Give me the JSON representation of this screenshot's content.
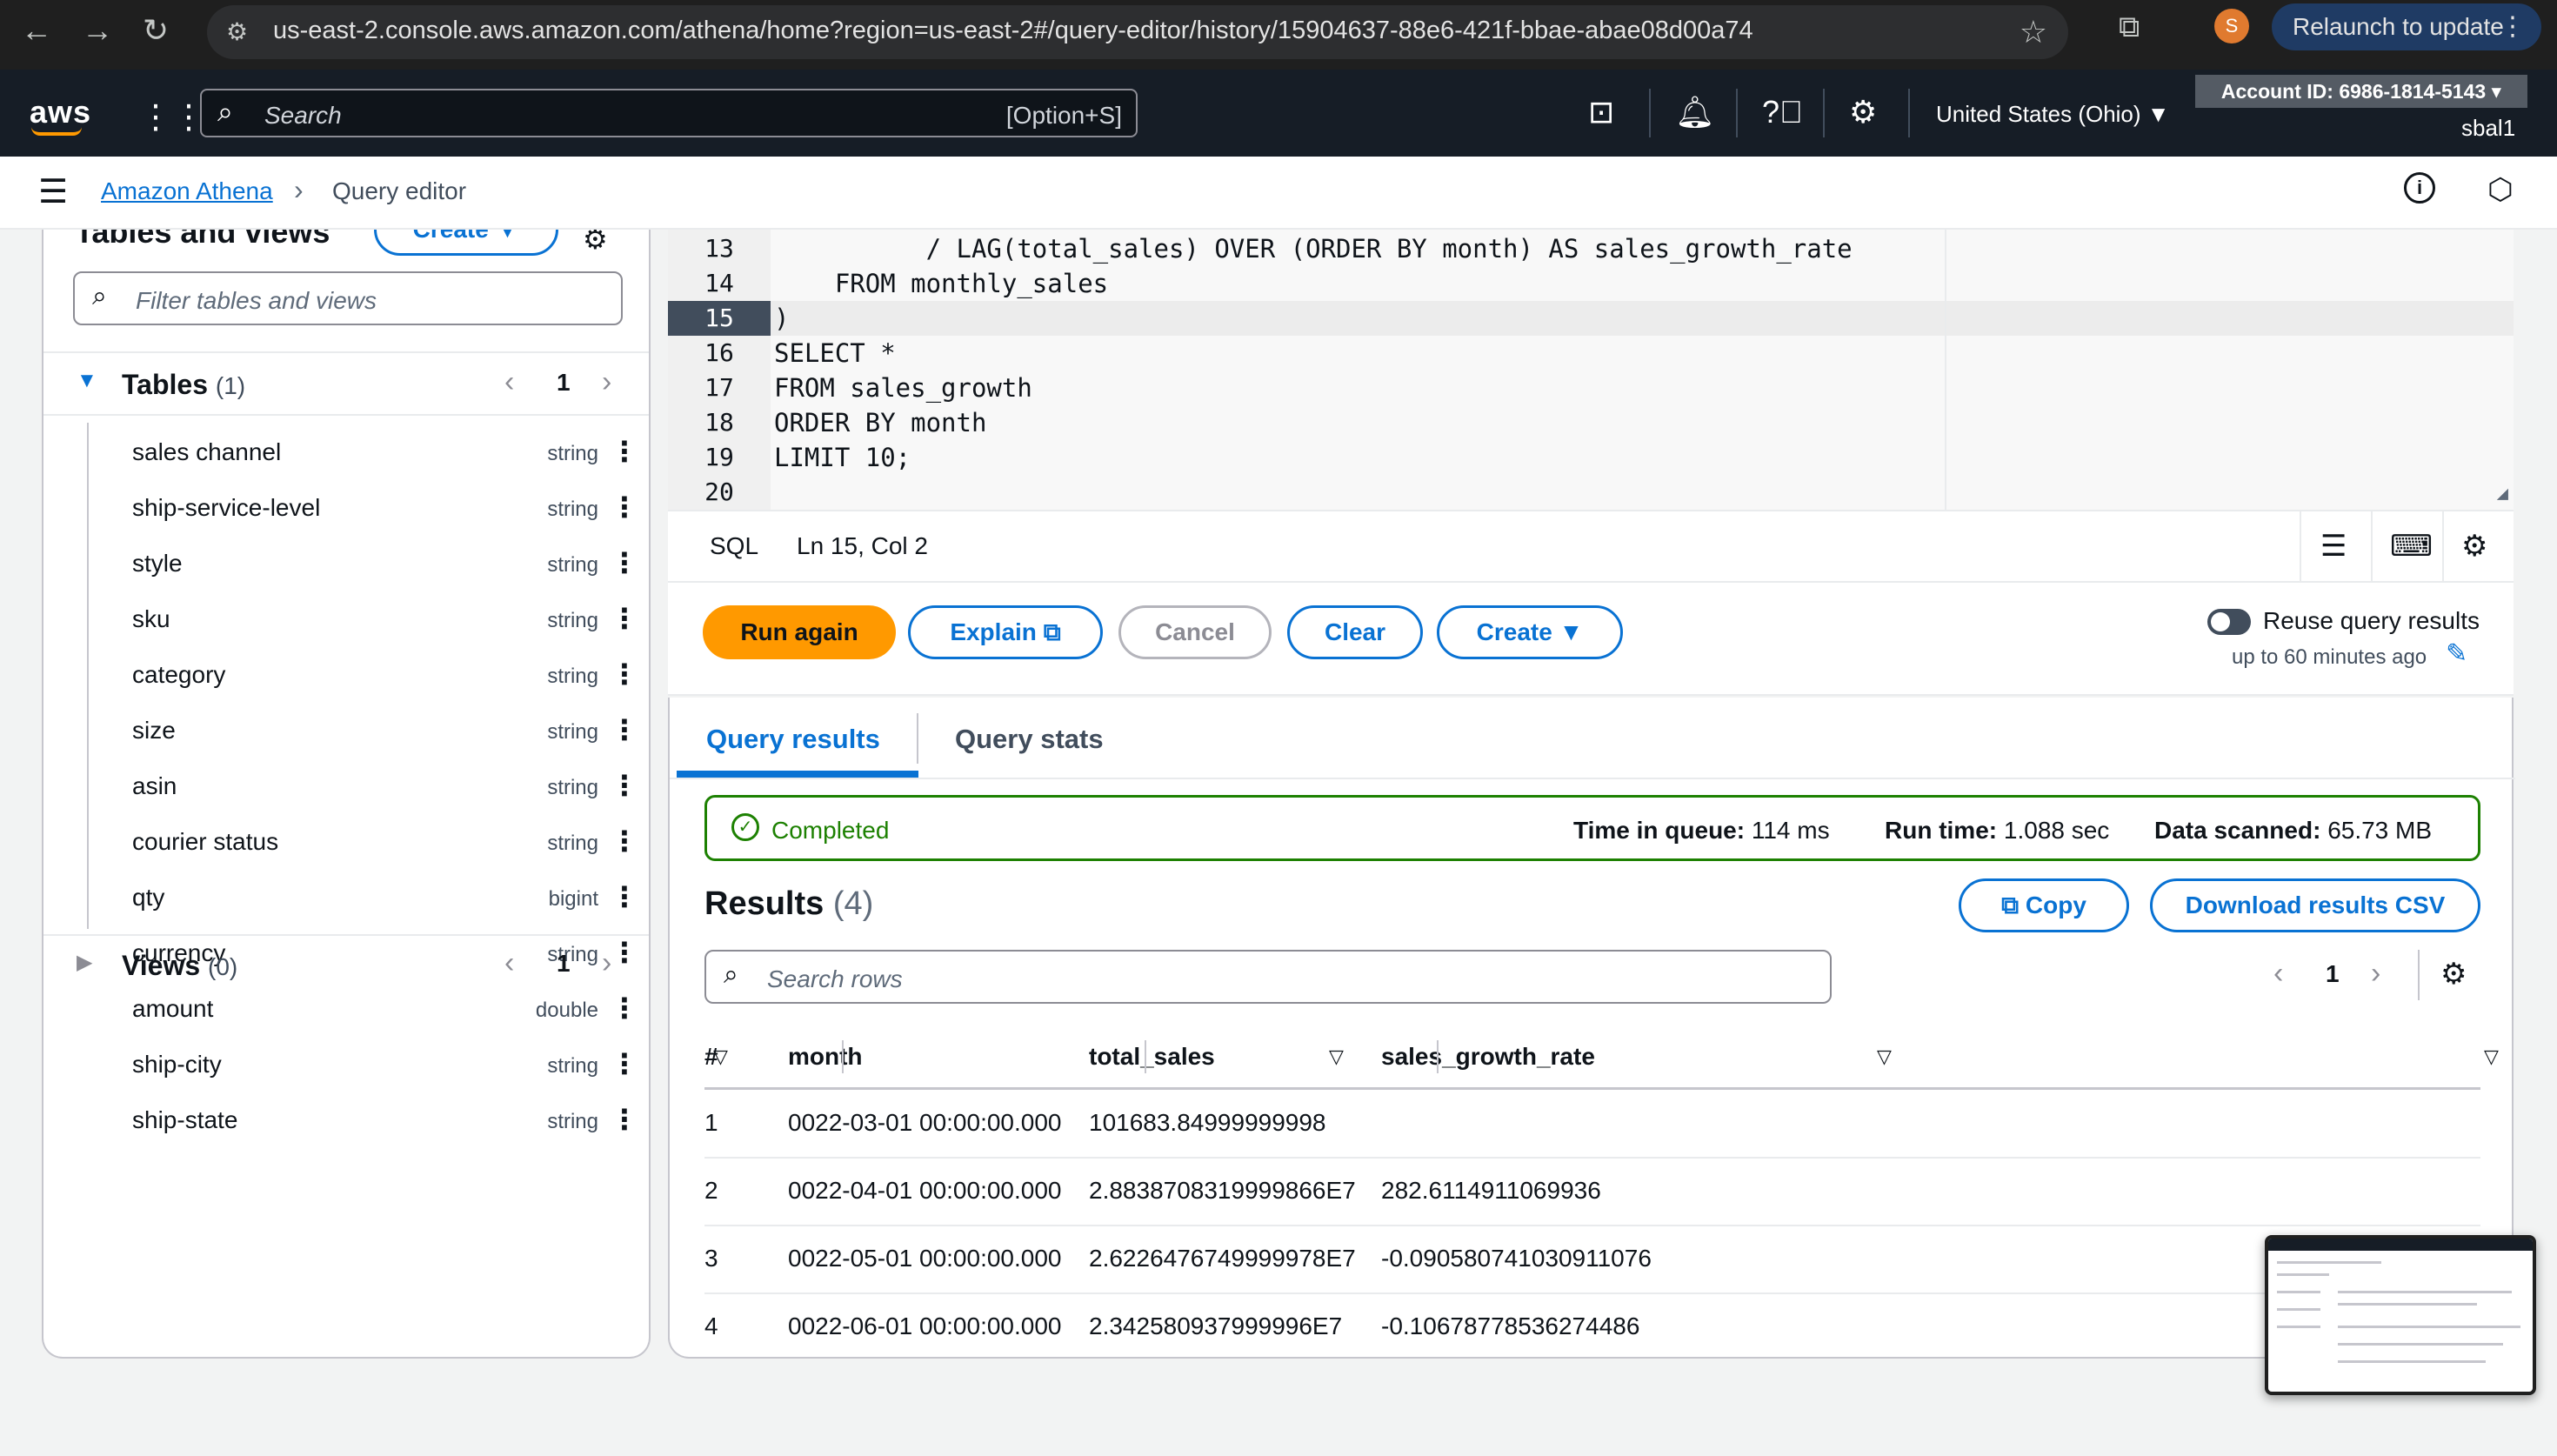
{
  "browser": {
    "url": "us-east-2.console.aws.amazon.com/athena/home?region=us-east-2#/query-editor/history/15904637-88e6-421f-bbae-abae08d00a74",
    "profile_initial": "S",
    "relaunch_label": "Relaunch to update"
  },
  "awsnav": {
    "logo": "aws",
    "search_placeholder": "Search",
    "search_shortcut": "[Option+S]",
    "region": "United States (Ohio)",
    "account": "Account ID: 6986-1814-5143",
    "user": "sbal1"
  },
  "breadcrumb": {
    "service": "Amazon Athena",
    "page": "Query editor"
  },
  "left_panel": {
    "title": "Tables and views",
    "create_label": "Create",
    "filter_placeholder": "Filter tables and views",
    "tables_label": "Tables",
    "tables_count": "(1)",
    "tables_page": "1",
    "views_label": "Views",
    "views_count": "(0)",
    "views_page": "1",
    "columns": [
      {
        "name": "sales channel",
        "type": "string"
      },
      {
        "name": "ship-service-level",
        "type": "string"
      },
      {
        "name": "style",
        "type": "string"
      },
      {
        "name": "sku",
        "type": "string"
      },
      {
        "name": "category",
        "type": "string"
      },
      {
        "name": "size",
        "type": "string"
      },
      {
        "name": "asin",
        "type": "string"
      },
      {
        "name": "courier status",
        "type": "string"
      },
      {
        "name": "qty",
        "type": "bigint"
      },
      {
        "name": "currency",
        "type": "string"
      },
      {
        "name": "amount",
        "type": "double"
      },
      {
        "name": "ship-city",
        "type": "string"
      },
      {
        "name": "ship-state",
        "type": "string"
      }
    ]
  },
  "editor": {
    "lines": [
      {
        "num": "13",
        "text": "          / LAG(total_sales) OVER (ORDER BY month) AS sales_growth_rate"
      },
      {
        "num": "14",
        "text": "    FROM monthly_sales"
      },
      {
        "num": "15",
        "text": ")"
      },
      {
        "num": "16",
        "text": "SELECT *"
      },
      {
        "num": "17",
        "text": "FROM sales_growth"
      },
      {
        "num": "18",
        "text": "ORDER BY month"
      },
      {
        "num": "19",
        "text": "LIMIT 10;"
      },
      {
        "num": "20",
        "text": ""
      }
    ],
    "current_line": "15",
    "language": "SQL",
    "cursor": "Ln 15, Col 2"
  },
  "actions": {
    "run_again": "Run again",
    "explain": "Explain",
    "cancel": "Cancel",
    "clear": "Clear",
    "create": "Create",
    "reuse_label": "Reuse query results",
    "reuse_sub": "up to 60 minutes ago"
  },
  "results": {
    "tab_results": "Query results",
    "tab_stats": "Query stats",
    "status": "Completed",
    "queue_label": "Time in queue:",
    "queue_value": "114 ms",
    "run_label": "Run time:",
    "run_value": "1.088 sec",
    "scan_label": "Data scanned:",
    "scan_value": "65.73 MB",
    "title": "Results",
    "count": "(4)",
    "copy_label": "Copy",
    "download_label": "Download results CSV",
    "search_placeholder": "Search rows",
    "page": "1",
    "columns": [
      "#",
      "month",
      "total_sales",
      "sales_growth_rate"
    ],
    "rows": [
      [
        "1",
        "0022-03-01 00:00:00.000",
        "101683.84999999998",
        ""
      ],
      [
        "2",
        "0022-04-01 00:00:00.000",
        "2.8838708319999866E7",
        "282.6114911069936"
      ],
      [
        "3",
        "0022-05-01 00:00:00.000",
        "2.6226476749999978E7",
        "-0.090580741030911076"
      ],
      [
        "4",
        "0022-06-01 00:00:00.000",
        "2.342580937999996E7",
        "-0.10678778536274486"
      ]
    ]
  },
  "colors": {
    "accent": "#0972d3",
    "primary_button": "#ff9900",
    "success": "#1d8102",
    "nav_bg": "#161d26"
  }
}
